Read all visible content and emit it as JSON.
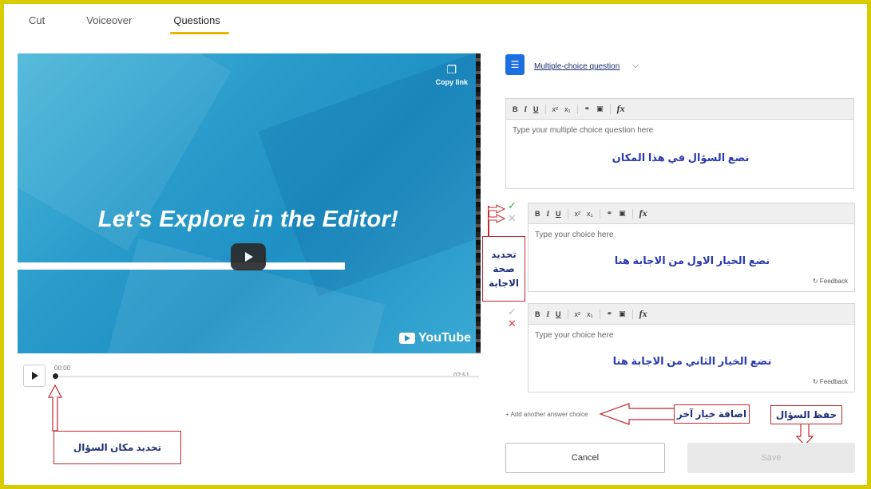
{
  "tabs": [
    {
      "label": "Cut"
    },
    {
      "label": "Voiceover"
    },
    {
      "label": "Questions"
    }
  ],
  "video": {
    "title": "Let's Explore in the Editor!",
    "copy_link": "Copy link",
    "youtube": "YouTube"
  },
  "timeline": {
    "start": "00:00",
    "end": "02:51"
  },
  "question_type": {
    "label": "Multiple-choice question",
    "icon": "list-icon"
  },
  "question_editor": {
    "placeholder": "Type your multiple choice question here",
    "annotation": "نضع السؤال في هذا المكان"
  },
  "choices": [
    {
      "placeholder": "Type your choice here",
      "feedback": "Feedback",
      "annotation": "نضع الخيار الاول من الاجابة هنا"
    },
    {
      "placeholder": "Type your choice here",
      "feedback": "Feedback",
      "annotation": "نضع الخيار الثاني من الاجابة هنا"
    }
  ],
  "toolbar": {
    "bold": "B",
    "italic": "I",
    "underline": "U",
    "superscript": "x²",
    "subscript": "x₁",
    "link": "⚭",
    "image": "▣",
    "formula": "fx"
  },
  "add_choice": "+ Add another answer choice",
  "buttons": {
    "cancel": "Cancel",
    "save": "Save"
  },
  "annotations": {
    "correctness_line1": "تحديد",
    "correctness_line2": "صحة",
    "correctness_line3": "الاجابة",
    "add_choice": "اضافة خيار آخر",
    "save_question": "حفظ السؤال",
    "question_position": "تحديد مكان السؤال"
  },
  "colors": {
    "frame": "#d8cc00",
    "accent": "#1d6fe0",
    "tab_underline": "#e8b600",
    "callout_border": "#c0282d"
  }
}
